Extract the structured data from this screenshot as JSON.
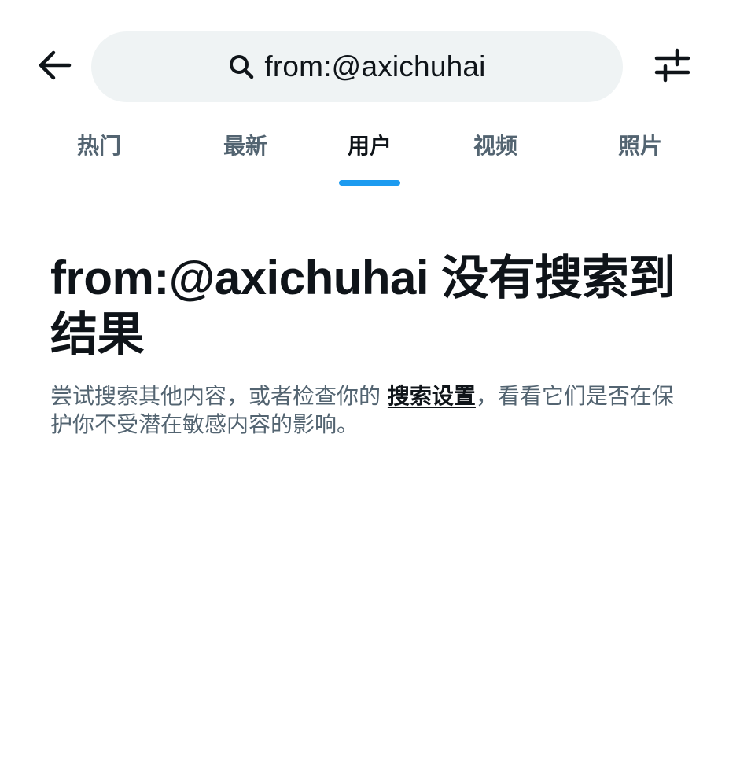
{
  "search": {
    "query": "from:@axichuhai",
    "icon": "search-icon"
  },
  "header": {
    "back_icon": "arrow-left-icon",
    "filter_icon": "sliders-icon"
  },
  "tabs": [
    {
      "label": "热门",
      "active": false
    },
    {
      "label": "最新",
      "active": false
    },
    {
      "label": "用户",
      "active": true
    },
    {
      "label": "视频",
      "active": false
    },
    {
      "label": "照片",
      "active": false
    }
  ],
  "empty_state": {
    "title": "from:@axichuhai 没有搜索到结果",
    "desc_before": "尝试搜索其他内容，或者检查你的 ",
    "desc_link": "搜索设置",
    "desc_after": "，看看它们是否在保护你不受潜在敏感内容的影响。"
  },
  "colors": {
    "accent": "#1d9bf0",
    "text_primary": "#0f1419",
    "text_secondary": "#536471",
    "search_bg": "#eff3f4"
  }
}
